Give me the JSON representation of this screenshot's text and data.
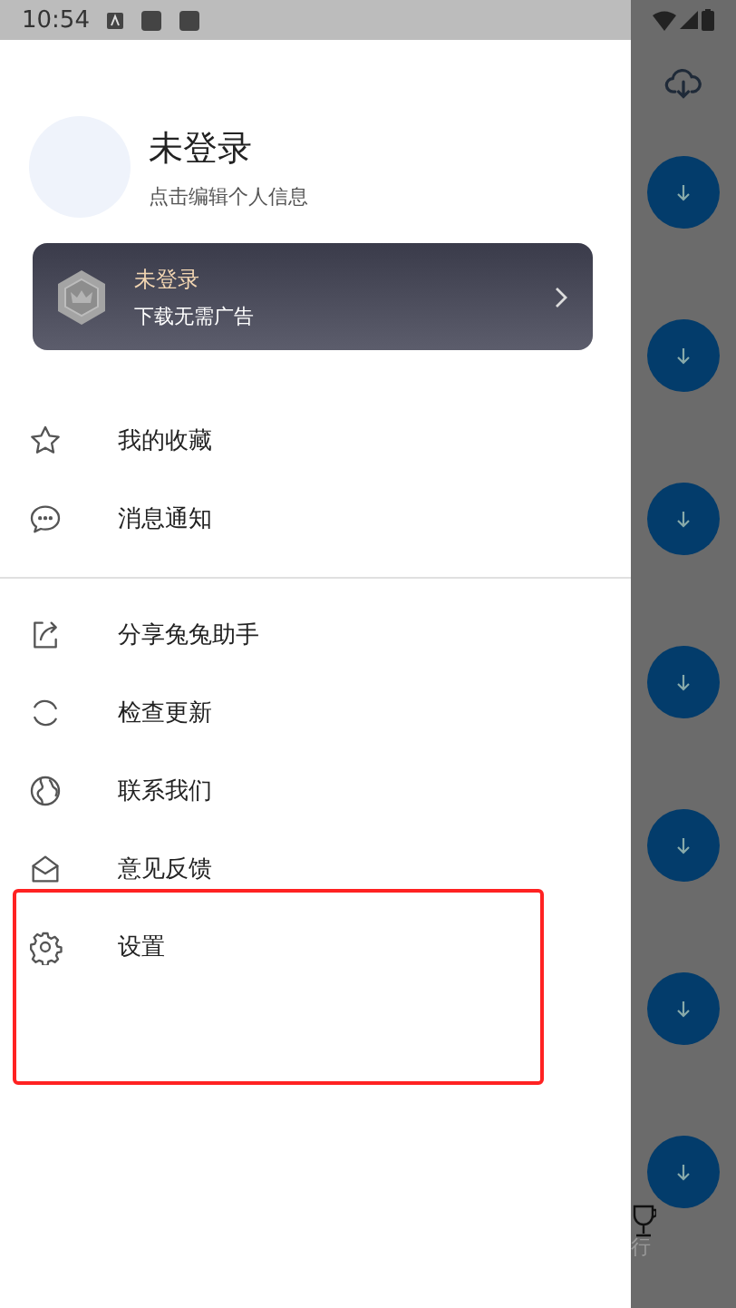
{
  "status_bar": {
    "time": "10:54"
  },
  "profile": {
    "name": "未登录",
    "hint": "点击编辑个人信息"
  },
  "vip_card": {
    "title": "未登录",
    "subtitle": "下载无需广告"
  },
  "menu_sections": [
    [
      {
        "label": "我的收藏"
      },
      {
        "label": "消息通知"
      }
    ],
    [
      {
        "label": "分享兔兔助手"
      },
      {
        "label": "检查更新"
      },
      {
        "label": "联系我们"
      },
      {
        "label": "意见反馈"
      },
      {
        "label": "设置"
      }
    ]
  ],
  "background_nav": {
    "label": "行"
  }
}
